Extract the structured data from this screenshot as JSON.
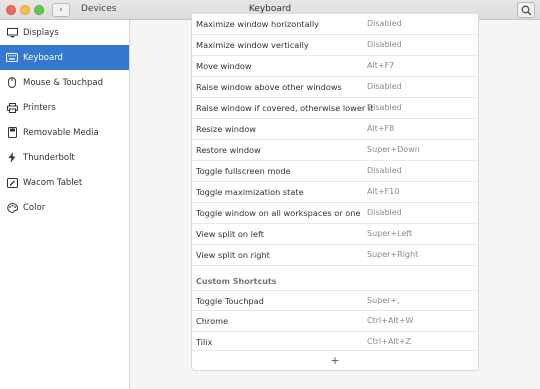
{
  "titlebar": {
    "section": "Devices",
    "title": "Keyboard",
    "back_icon": "‹"
  },
  "sidebar": {
    "items": [
      {
        "label": "Displays",
        "icon": "display-icon"
      },
      {
        "label": "Keyboard",
        "icon": "keyboard-icon",
        "active": true
      },
      {
        "label": "Mouse & Touchpad",
        "icon": "mouse-icon"
      },
      {
        "label": "Printers",
        "icon": "printer-icon"
      },
      {
        "label": "Removable Media",
        "icon": "media-icon"
      },
      {
        "label": "Thunderbolt",
        "icon": "thunderbolt-icon"
      },
      {
        "label": "Wacom Tablet",
        "icon": "tablet-icon"
      },
      {
        "label": "Color",
        "icon": "color-icon"
      }
    ]
  },
  "shortcuts": [
    {
      "name": "Maximize window horizontally",
      "accel": "Disabled"
    },
    {
      "name": "Maximize window vertically",
      "accel": "Disabled"
    },
    {
      "name": "Move window",
      "accel": "Alt+F7"
    },
    {
      "name": "Raise window above other windows",
      "accel": "Disabled"
    },
    {
      "name": "Raise window if covered, otherwise lower it",
      "accel": "Disabled"
    },
    {
      "name": "Resize window",
      "accel": "Alt+F8"
    },
    {
      "name": "Restore window",
      "accel": "Super+Down"
    },
    {
      "name": "Toggle fullscreen mode",
      "accel": "Disabled"
    },
    {
      "name": "Toggle maximization state",
      "accel": "Alt+F10"
    },
    {
      "name": "Toggle window on all workspaces or one",
      "accel": "Disabled"
    },
    {
      "name": "View split on left",
      "accel": "Super+Left"
    },
    {
      "name": "View split on right",
      "accel": "Super+Right"
    }
  ],
  "custom": {
    "header": "Custom Shortcuts",
    "items": [
      {
        "name": "Toggle Touchpad",
        "accel": "Super+,"
      },
      {
        "name": "Chrome",
        "accel": "Ctrl+Alt+W"
      },
      {
        "name": "Tilix",
        "accel": "Ctrl+Alt+Z"
      }
    ],
    "add_label": "+"
  },
  "colors": {
    "accent": "#3478d0"
  }
}
